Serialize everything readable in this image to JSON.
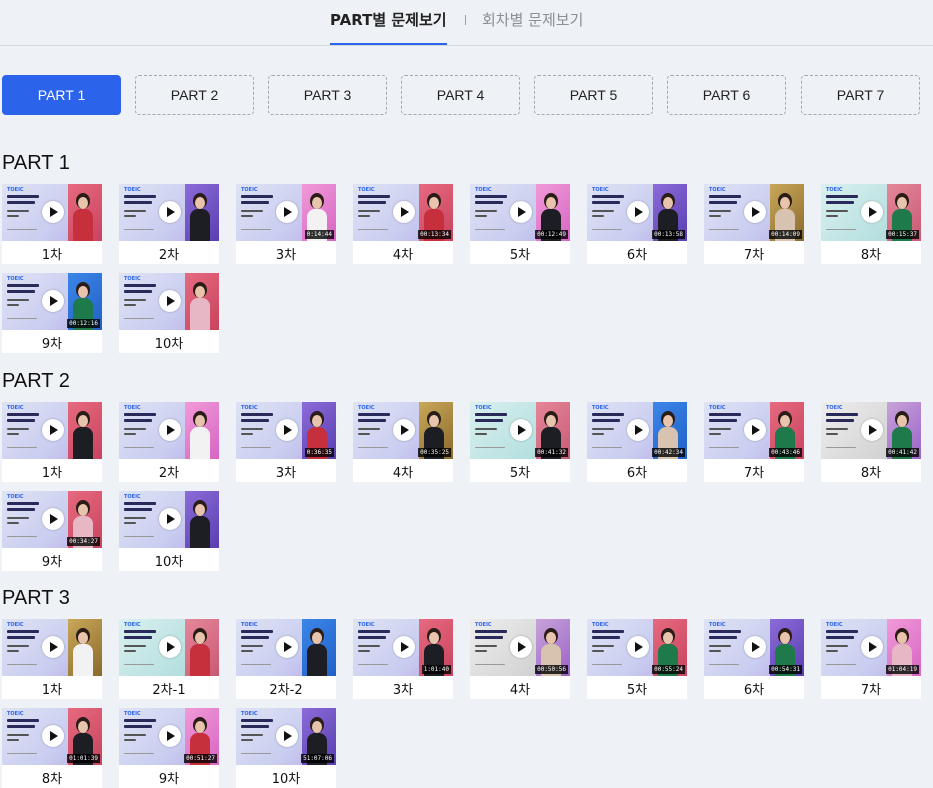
{
  "tabs": {
    "part": "PART별 문제보기",
    "round": "회차별 문제보기"
  },
  "part_buttons": [
    "PART 1",
    "PART 2",
    "PART 3",
    "PART 4",
    "PART 5",
    "PART 6",
    "PART 7"
  ],
  "colors": {
    "accent": "#2b63ea",
    "page_bg": "#eef1f5"
  },
  "thumbnail": {
    "badge": "TOEIC",
    "play_icon": "play-icon"
  },
  "sections": [
    {
      "title": "PART 1",
      "cards": [
        {
          "label": "1차",
          "duration": ""
        },
        {
          "label": "2차",
          "duration": ""
        },
        {
          "label": "3차",
          "duration": "0:14:44"
        },
        {
          "label": "4차",
          "duration": "00:13:34"
        },
        {
          "label": "5차",
          "duration": "00:12:49"
        },
        {
          "label": "6차",
          "duration": "00:13:58"
        },
        {
          "label": "7차",
          "duration": "00:14:09"
        },
        {
          "label": "8차",
          "duration": "00:15:37"
        },
        {
          "label": "9차",
          "duration": "00:12:16"
        },
        {
          "label": "10차",
          "duration": ""
        }
      ]
    },
    {
      "title": "PART 2",
      "cards": [
        {
          "label": "1차",
          "duration": ""
        },
        {
          "label": "2차",
          "duration": ""
        },
        {
          "label": "3차",
          "duration": "0:36:35"
        },
        {
          "label": "4차",
          "duration": "00:35:25"
        },
        {
          "label": "5차",
          "duration": "00:41:32"
        },
        {
          "label": "6차",
          "duration": "00:42:34"
        },
        {
          "label": "7차",
          "duration": "00:43:46"
        },
        {
          "label": "8차",
          "duration": "00:41:42"
        },
        {
          "label": "9차",
          "duration": "00:34:27"
        },
        {
          "label": "10차",
          "duration": ""
        }
      ]
    },
    {
      "title": "PART 3",
      "cards": [
        {
          "label": "1차",
          "duration": ""
        },
        {
          "label": "2차-1",
          "duration": ""
        },
        {
          "label": "2차-2",
          "duration": ""
        },
        {
          "label": "3차",
          "duration": "1:01:40"
        },
        {
          "label": "4차",
          "duration": "00:50:56"
        },
        {
          "label": "5차",
          "duration": "00:55:24"
        },
        {
          "label": "6차",
          "duration": "00:54:31"
        },
        {
          "label": "7차",
          "duration": "01:04:19"
        },
        {
          "label": "8차",
          "duration": "01:01:39"
        },
        {
          "label": "9차",
          "duration": "00:51:27"
        },
        {
          "label": "10차",
          "duration": "51:07:06"
        }
      ]
    }
  ]
}
